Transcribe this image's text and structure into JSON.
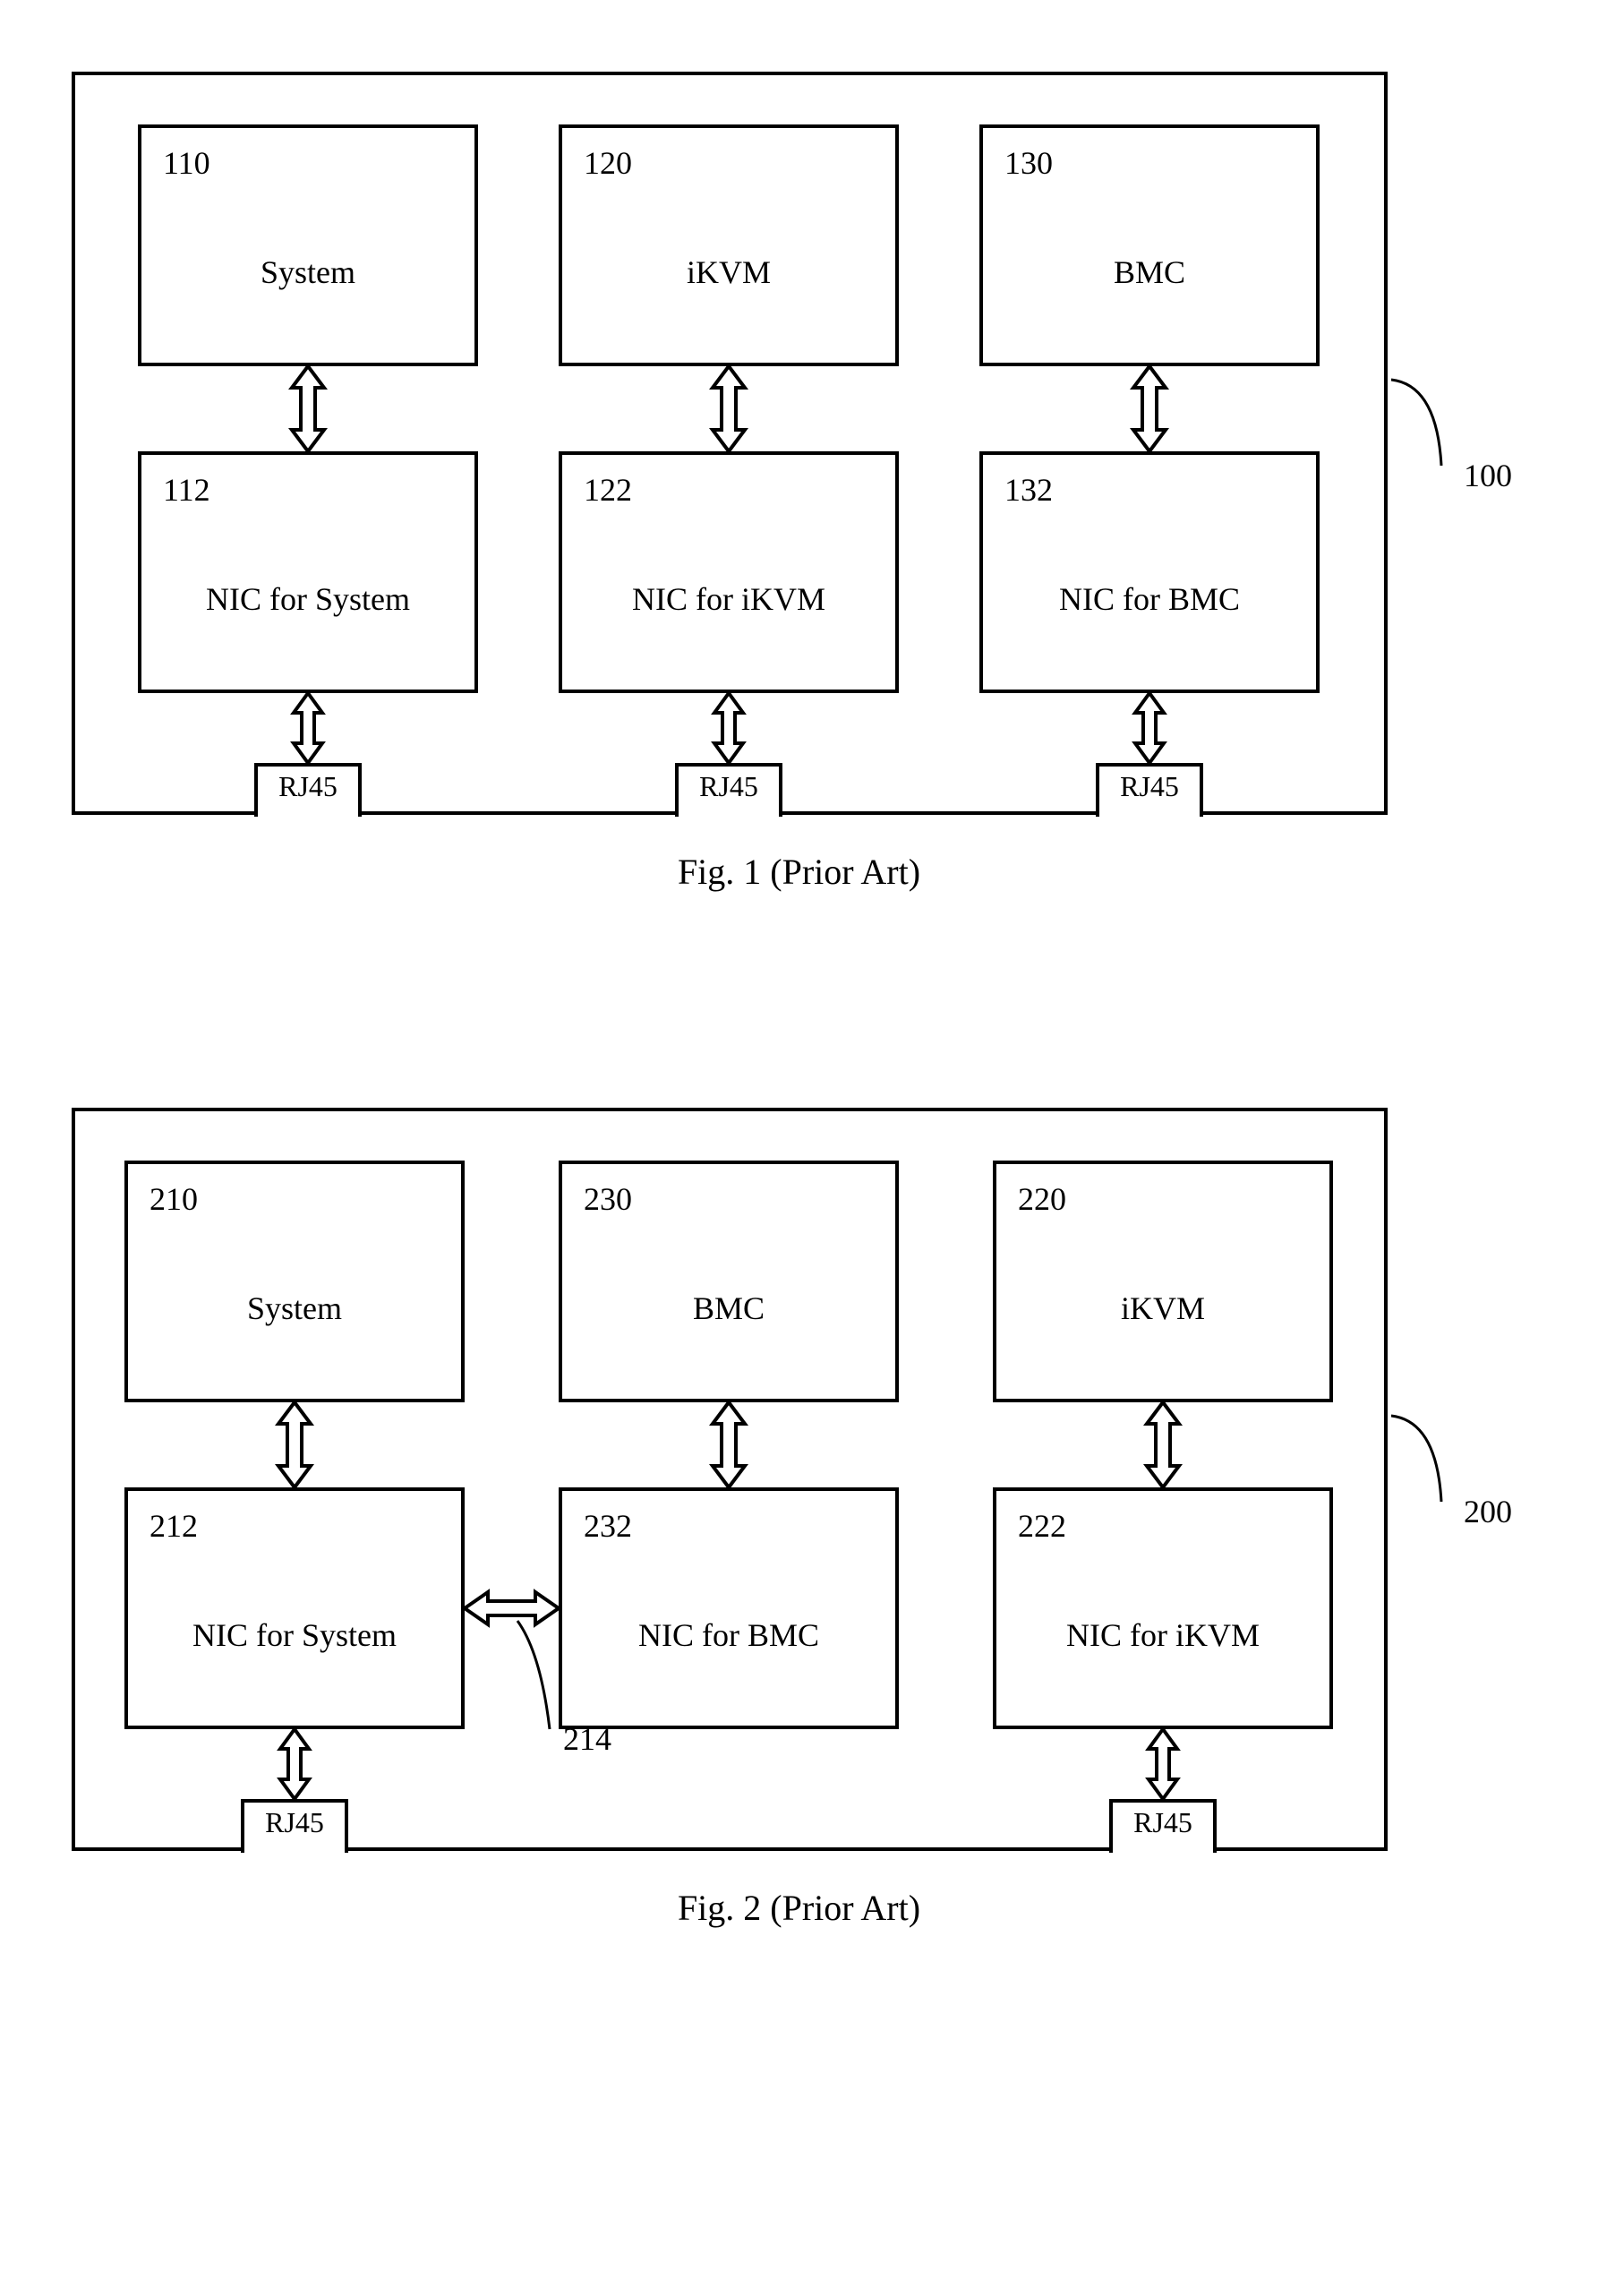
{
  "fig1": {
    "caption": "Fig. 1 (Prior Art)",
    "board_ref": "100",
    "boxes": {
      "b110": {
        "num": "110",
        "label": "System"
      },
      "b120": {
        "num": "120",
        "label": "iKVM"
      },
      "b130": {
        "num": "130",
        "label": "BMC"
      },
      "b112": {
        "num": "112",
        "label": "NIC for System"
      },
      "b122": {
        "num": "122",
        "label": "NIC for iKVM"
      },
      "b132": {
        "num": "132",
        "label": "NIC for BMC"
      }
    },
    "rj45": "RJ45"
  },
  "fig2": {
    "caption": "Fig. 2 (Prior Art)",
    "board_ref": "200",
    "side_ref": "214",
    "boxes": {
      "b210": {
        "num": "210",
        "label": "System"
      },
      "b230": {
        "num": "230",
        "label": "BMC"
      },
      "b220": {
        "num": "220",
        "label": "iKVM"
      },
      "b212": {
        "num": "212",
        "label": "NIC for System"
      },
      "b232": {
        "num": "232",
        "label": "NIC for BMC"
      },
      "b222": {
        "num": "222",
        "label": "NIC for iKVM"
      }
    },
    "rj45": "RJ45"
  }
}
